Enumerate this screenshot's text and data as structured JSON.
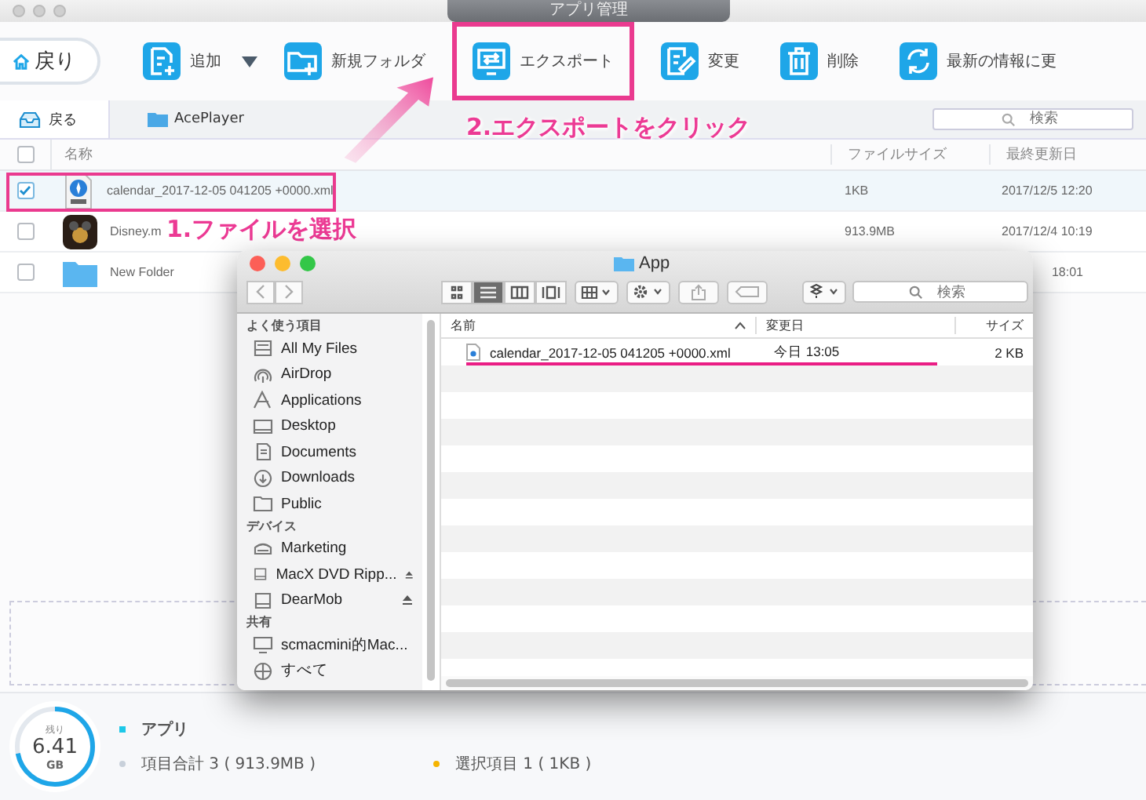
{
  "window": {
    "title": "アプリ管理"
  },
  "toolbar": {
    "back": {
      "label": "戻り"
    },
    "buttons": [
      {
        "kind": "add",
        "label": "追加",
        "dropdown": true,
        "highlighted": false
      },
      {
        "kind": "folder",
        "label": "新規フォルダ",
        "dropdown": false,
        "highlighted": false
      },
      {
        "kind": "export",
        "label": "エクスポート",
        "dropdown": false,
        "highlighted": true
      },
      {
        "kind": "edit",
        "label": "変更",
        "dropdown": false,
        "highlighted": false
      },
      {
        "kind": "delete",
        "label": "削除",
        "dropdown": false,
        "highlighted": false
      },
      {
        "kind": "refresh",
        "label": "最新の情報に更",
        "dropdown": false,
        "highlighted": false
      }
    ]
  },
  "nav": {
    "back": "戻る",
    "path": "AcePlayer",
    "search": {
      "placeholder": "検索"
    }
  },
  "table": {
    "columns": [
      "名称",
      "ファイルサイズ",
      "最終更新日"
    ],
    "header_checked": false,
    "rows": [
      {
        "kind": "xml",
        "name": "calendar_2017-12-05 041205 +0000.xml",
        "size": "1KB",
        "date": "2017/12/5  12:20",
        "checked": true,
        "selected": true,
        "highlighted": true
      },
      {
        "kind": "app",
        "name": "Disney.m",
        "size": "913.9MB",
        "date": "2017/12/4  10:19",
        "checked": false,
        "selected": false,
        "highlighted": false
      },
      {
        "kind": "folder",
        "name": "New Folder",
        "date": "18:01",
        "checked": false,
        "selected": false,
        "highlighted": false
      }
    ]
  },
  "storage": {
    "caption": "残り",
    "value": "6.41",
    "unit": "GB",
    "level": 0.72
  },
  "legend": [
    {
      "label": "アプリ",
      "color": "#1ec8e8"
    },
    {
      "label": "項目合計 3 ( 913.9MB )",
      "color": "#c8d0da"
    },
    {
      "label": "選択項目 1 ( 1KB )",
      "color": "#f5b400"
    }
  ],
  "annotations": [
    {
      "text": "1.ファイルを選択"
    },
    {
      "text": "2.エクスポートをクリック"
    }
  ],
  "dialog": {
    "title": "App",
    "search": {
      "placeholder": "検索"
    },
    "views": [
      {
        "kind": "icons",
        "selected": false
      },
      {
        "kind": "list",
        "selected": true
      },
      {
        "kind": "columns",
        "selected": false
      },
      {
        "kind": "coverflow",
        "selected": false
      }
    ],
    "sidebar": [
      {
        "heading": "よく使う項目",
        "items": [
          {
            "kind": "files",
            "label": "All My Files",
            "ejectable": false
          },
          {
            "kind": "airdrop",
            "label": "AirDrop",
            "ejectable": false
          },
          {
            "kind": "apps",
            "label": "Applications",
            "ejectable": false
          },
          {
            "kind": "desktop",
            "label": "Desktop",
            "ejectable": false
          },
          {
            "kind": "documents",
            "label": "Documents",
            "ejectable": false
          },
          {
            "kind": "downloads",
            "label": "Downloads",
            "ejectable": false
          },
          {
            "kind": "folder",
            "label": "Public",
            "ejectable": false
          }
        ]
      },
      {
        "heading": "デバイス",
        "items": [
          {
            "kind": "network",
            "label": "Marketing",
            "ejectable": false
          },
          {
            "kind": "disk",
            "label": "MacX DVD Ripp...",
            "ejectable": true
          },
          {
            "kind": "disk",
            "label": "DearMob",
            "ejectable": true
          }
        ]
      },
      {
        "heading": "共有",
        "items": [
          {
            "kind": "computer",
            "label": "scmacmini的Mac...",
            "ejectable": false
          },
          {
            "kind": "globe",
            "label": "すべて",
            "ejectable": false
          }
        ]
      }
    ],
    "columns": [
      "名前",
      "変更日",
      "サイズ"
    ],
    "files": [
      {
        "name": "calendar_2017-12-05 041205 +0000.xml",
        "date": "今日 13:05",
        "size": "2 KB",
        "underlined": true
      }
    ]
  }
}
